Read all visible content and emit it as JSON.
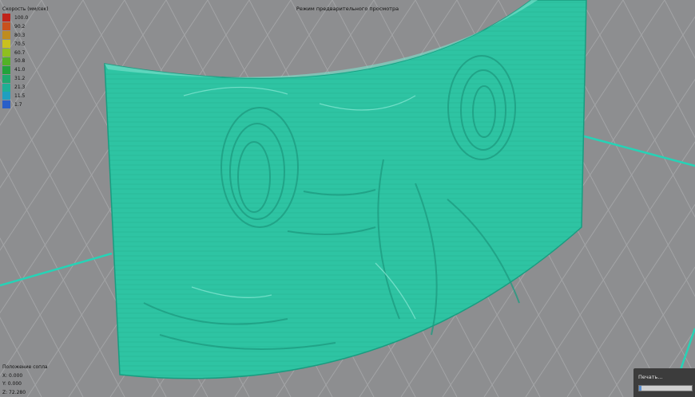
{
  "viewport_title": "Режим предварительного просмотра",
  "legend": {
    "title": "Скорость (мм/сек)",
    "items": [
      {
        "label": "100.0",
        "color": "#c0231a"
      },
      {
        "label": "90.2",
        "color": "#c8511d"
      },
      {
        "label": "80.3",
        "color": "#bf8c1f"
      },
      {
        "label": "70.5",
        "color": "#c9c11f"
      },
      {
        "label": "60.7",
        "color": "#8fbf1f"
      },
      {
        "label": "50.8",
        "color": "#52b225"
      },
      {
        "label": "41.0",
        "color": "#22a33a"
      },
      {
        "label": "31.2",
        "color": "#1fa96d"
      },
      {
        "label": "21.3",
        "color": "#1faf95"
      },
      {
        "label": "11.5",
        "color": "#1f9fc0"
      },
      {
        "label": "1.7",
        "color": "#2a5fc8"
      }
    ]
  },
  "nozzle": {
    "title": "Положение сопла",
    "x": "X: 0.000",
    "y": "Y: 0.000",
    "z": "Z: 72.280"
  },
  "print_status": {
    "label": "Печать...",
    "progress": 0.05
  },
  "colors": {
    "model": "#2ec4a3",
    "bed": "#8d8e90",
    "grid": "#a3a4a6",
    "bed_outline": "#26d3b6"
  }
}
